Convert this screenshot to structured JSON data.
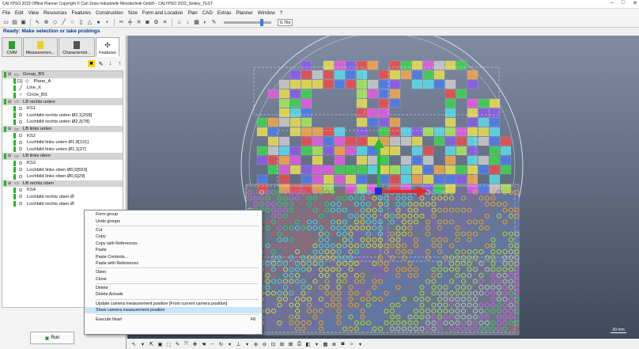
{
  "window": {
    "title": "CALYPSO 2022 Offline Planner Copyright © Carl Zeiss Industrielle Messtechnik GmbH - CALYPSO 2022_Smiley_TEST",
    "controls": [
      "–",
      "□",
      "✕"
    ]
  },
  "menu": [
    "File",
    "Edit",
    "View",
    "Resources",
    "Features",
    "Construction",
    "Size",
    "Form and Location",
    "Plan",
    "CAD",
    "Extras",
    "Planner",
    "Window",
    "?"
  ],
  "toolbar": {
    "zoom_value": "0.76x"
  },
  "status": "Ready: Make selection or take probings",
  "tabs": [
    {
      "label": "CMM",
      "color": "#2e9e2e"
    },
    {
      "label": "Measuremen...",
      "color": "#e8d21c"
    },
    {
      "label": "Characteristi...",
      "color": "#555555"
    },
    {
      "label": "Features",
      "color": "#333333"
    }
  ],
  "tree": [
    {
      "kind": "group",
      "label": "Group_BS"
    },
    {
      "kind": "child",
      "icon": "◇",
      "label": "Plane_A",
      "prefix": "[1]"
    },
    {
      "kind": "child",
      "icon": "╱",
      "label": "Line_X"
    },
    {
      "kind": "child",
      "icon": "○",
      "label": "Circle_BS"
    },
    {
      "kind": "group",
      "label": "LB rechts unten"
    },
    {
      "kind": "child",
      "icon": "⊙",
      "label": "KS1"
    },
    {
      "kind": "child",
      "icon": "⊙",
      "label": "Lochbild rechts unten Ø2,1[258]"
    },
    {
      "kind": "child",
      "icon": "⊙",
      "label": "Lochbild rechts unten Ø2,2[78]"
    },
    {
      "kind": "group",
      "label": "LB links unten"
    },
    {
      "kind": "child",
      "icon": "⊙",
      "label": "KS2"
    },
    {
      "kind": "child",
      "icon": "⊙",
      "label": "Lochbild links unten Ø1,8[131]"
    },
    {
      "kind": "child",
      "icon": "⊙",
      "label": "Lochbild links unten Ø1,1[27]"
    },
    {
      "kind": "group",
      "label": "LB links oben"
    },
    {
      "kind": "child",
      "icon": "⊙",
      "label": "KS3"
    },
    {
      "kind": "child",
      "icon": "⊙",
      "label": "Lochbild links oben Ø0,5[553]"
    },
    {
      "kind": "child",
      "icon": "⊙",
      "label": "Lochbild links oben Ø0,6[29]"
    },
    {
      "kind": "group",
      "label": "LB rechts oben"
    },
    {
      "kind": "child",
      "icon": "⊙",
      "label": "KS4"
    },
    {
      "kind": "child",
      "icon": "⊙",
      "label": "Lochbild rechts oben Ø"
    },
    {
      "kind": "child",
      "icon": "⊙",
      "label": "Lochbild rechts oben Ø"
    }
  ],
  "run_button": "Run",
  "context_menu": [
    {
      "label": "Form group"
    },
    {
      "label": "Undo groups"
    },
    {
      "sep": true
    },
    {
      "label": "Cut"
    },
    {
      "label": "Copy"
    },
    {
      "label": "Copy with References"
    },
    {
      "label": "Paste"
    },
    {
      "label": "Paste Contents..."
    },
    {
      "label": "Paste with References"
    },
    {
      "sep": true
    },
    {
      "label": "Open"
    },
    {
      "label": "Close"
    },
    {
      "sep": true
    },
    {
      "label": "Delete"
    },
    {
      "label": "Delete Actuals"
    },
    {
      "sep": true
    },
    {
      "label": "Update camera measurement position   [From current camera position]"
    },
    {
      "label": "Show camera measurement position",
      "highlight": true
    },
    {
      "sep": true
    },
    {
      "label": "Execute Now!",
      "shortcut": "F8"
    }
  ],
  "scale_label": "20 mm",
  "colors": {
    "viewport_bg": "#5f6c82",
    "status_text": "#003a8c",
    "group_bar": "#25b525"
  }
}
